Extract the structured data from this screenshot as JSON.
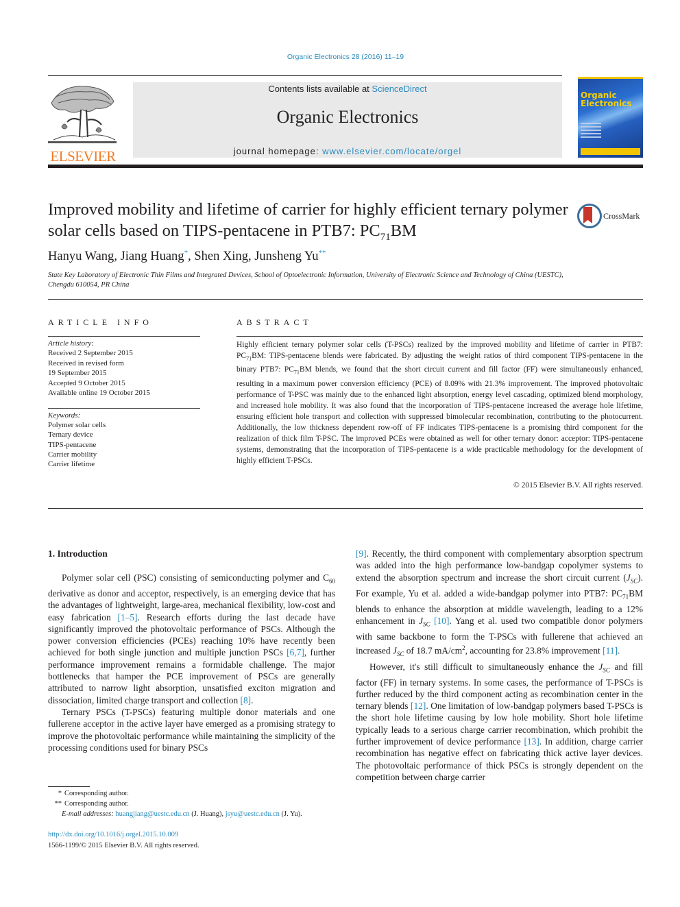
{
  "header": {
    "journal_ref": "Organic Electronics 28 (2016) 11–19",
    "contents_prefix": "Contents lists available at ",
    "contents_link": "ScienceDirect",
    "journal_name": "Organic Electronics",
    "homepage_prefix": "journal homepage: ",
    "homepage_link": "www.elsevier.com/locate/orgel",
    "publisher_logo_text": "ELSEVIER",
    "cover_title_line1": "Organic",
    "cover_title_line2": "Electronics",
    "publisher_color": "#f47a20",
    "link_color": "#2a8bbd"
  },
  "article": {
    "title_part1": "Improved mobility and lifetime of carrier for highly efficient ternary polymer solar cells based on TIPS-pentacene in PTB7: PC",
    "title_sub": "71",
    "title_part2": "BM",
    "crossmark_label": "CrossMark",
    "authors": [
      {
        "name": "Hanyu Wang",
        "mark": ""
      },
      {
        "name": "Jiang Huang",
        "mark": "*"
      },
      {
        "name": "Shen Xing",
        "mark": ""
      },
      {
        "name": "Junsheng Yu",
        "mark": "**"
      }
    ],
    "affiliation": "State Key Laboratory of Electronic Thin Films and Integrated Devices, School of Optoelectronic Information, University of Electronic Science and Technology of China (UESTC), Chengdu 610054, PR China"
  },
  "article_info": {
    "label": "ARTICLE INFO",
    "history_label": "Article history:",
    "history": [
      "Received 2 September 2015",
      "Received in revised form",
      "19 September 2015",
      "Accepted 9 October 2015",
      "Available online 19 October 2015"
    ],
    "keywords_label": "Keywords:",
    "keywords": [
      "Polymer solar cells",
      "Ternary device",
      "TIPS-pentacene",
      "Carrier mobility",
      "Carrier lifetime"
    ]
  },
  "abstract": {
    "label": "ABSTRACT",
    "text_a": "Highly efficient ternary polymer solar cells (T-PSCs) realized by the improved mobility and lifetime of carrier in PTB7: PC",
    "sub": "71",
    "text_b": "BM: TIPS-pentacene blends were fabricated. By adjusting the weight ratios of third component TIPS-pentacene in the binary PTB7: PC",
    "text_c": "BM blends, we found that the short circuit current and fill factor (FF) were simultaneously enhanced, resulting in a maximum power conversion efficiency (PCE) of 8.09% with 21.3% improvement. The improved photovoltaic performance of T-PSC was mainly due to the enhanced light absorption, energy level cascading, optimized blend morphology, and increased hole mobility. It was also found that the incorporation of TIPS-pentacene increased the average hole lifetime, ensuring efficient hole transport and collection with suppressed bimolecular recombination, contributing to the photocurrent. Additionally, the low thickness dependent row-off of FF indicates TIPS-pentacene is a promising third component for the realization of thick film T-PSC. The improved PCEs were obtained as well for other ternary donor: acceptor: TIPS-pentacene systems, demonstrating that the incorporation of TIPS-pentacene is a wide practicable methodology for the development of highly efficient T-PSCs.",
    "copyright": "© 2015 Elsevier B.V. All rights reserved."
  },
  "body": {
    "section_heading": "1.  Introduction",
    "p1_a": "Polymer solar cell (PSC) consisting of semiconducting polymer and C",
    "p1_sub": "60",
    "p1_b": " derivative as donor and acceptor, respectively, is an emerging device that has the advantages of lightweight, large-area, mechanical flexibility, low-cost and easy fabrication ",
    "ref_1_5": "[1–5]",
    "p1_c": ". Research efforts during the last decade have significantly improved the photovoltaic performance of PSCs. Although the power conversion efficiencies (PCEs) reaching 10% have recently been achieved for both single junction and multiple junction PSCs ",
    "ref_6_7": "[6,7]",
    "p1_d": ", further performance improvement remains a formidable challenge. The major bottlenecks that hamper the PCE improvement of PSCs are generally attributed to narrow light absorption, unsatisfied exciton migration and dissociation, limited charge transport and collection ",
    "ref_8": "[8]",
    "p1_e": ".",
    "p2_a": "Ternary PSCs (T-PSCs) featuring multiple donor materials and one fullerene acceptor in the active layer have emerged as a promising strategy to improve the photovoltaic performance while maintaining the simplicity of the processing conditions used for binary PSCs ",
    "ref_9": "[9]",
    "p2_b": ". Recently, the third component with complementary absorption spectrum was added into the high performance low-bandgap copolymer systems to extend the absorption spectrum and increase the short circuit current (",
    "jsc": "J",
    "jsc_sub": "SC",
    "p2_c": "). For example, Yu et al. added a wide-bandgap polymer into PTB7: PC",
    "p2_sub71": "71",
    "p2_d": "BM blends to enhance the absorption at middle wavelength, leading to a 12% enhancement in ",
    "ref_10": "[10]",
    "p2_e": ". Yang et al. used two compatible donor polymers with same backbone to form the T-PSCs with fullerene that achieved an increased ",
    "p2_f": " of 18.7 mA/cm",
    "p2_sup2": "2",
    "p2_g": ", accounting for 23.8% improvement ",
    "ref_11": "[11]",
    "p2_h": ".",
    "p3_a": "However, it's still difficult to simultaneously enhance the ",
    "p3_b": " and fill factor (FF) in ternary systems. In some cases, the performance of T-PSCs is further reduced by the third component acting as recombination center in the ternary blends ",
    "ref_12": "[12]",
    "p3_c": ". One limitation of low-bandgap polymers based T-PSCs is the short hole lifetime causing by low hole mobility. Short hole lifetime typically leads to a serious charge carrier recombination, which prohibit the further improvement of device performance ",
    "ref_13": "[13]",
    "p3_d": ". In addition, charge carrier recombination has negative effect on fabricating thick active layer devices. The photovoltaic performance of thick PSCs is strongly dependent on the competition between charge carrier"
  },
  "footnotes": {
    "mark1": "*",
    "text1": "Corresponding author.",
    "mark2": "**",
    "text2": "Corresponding author.",
    "email_label": "E-mail addresses: ",
    "email1": "huangjiang@uestc.edu.cn",
    "email1_who": " (J. Huang), ",
    "email2": "jsyu@uestc.edu.cn",
    "email2_who": " (J. Yu).",
    "doi": "http://dx.doi.org/10.1016/j.orgel.2015.10.009",
    "issn_line": "1566-1199/© 2015 Elsevier B.V. All rights reserved."
  }
}
